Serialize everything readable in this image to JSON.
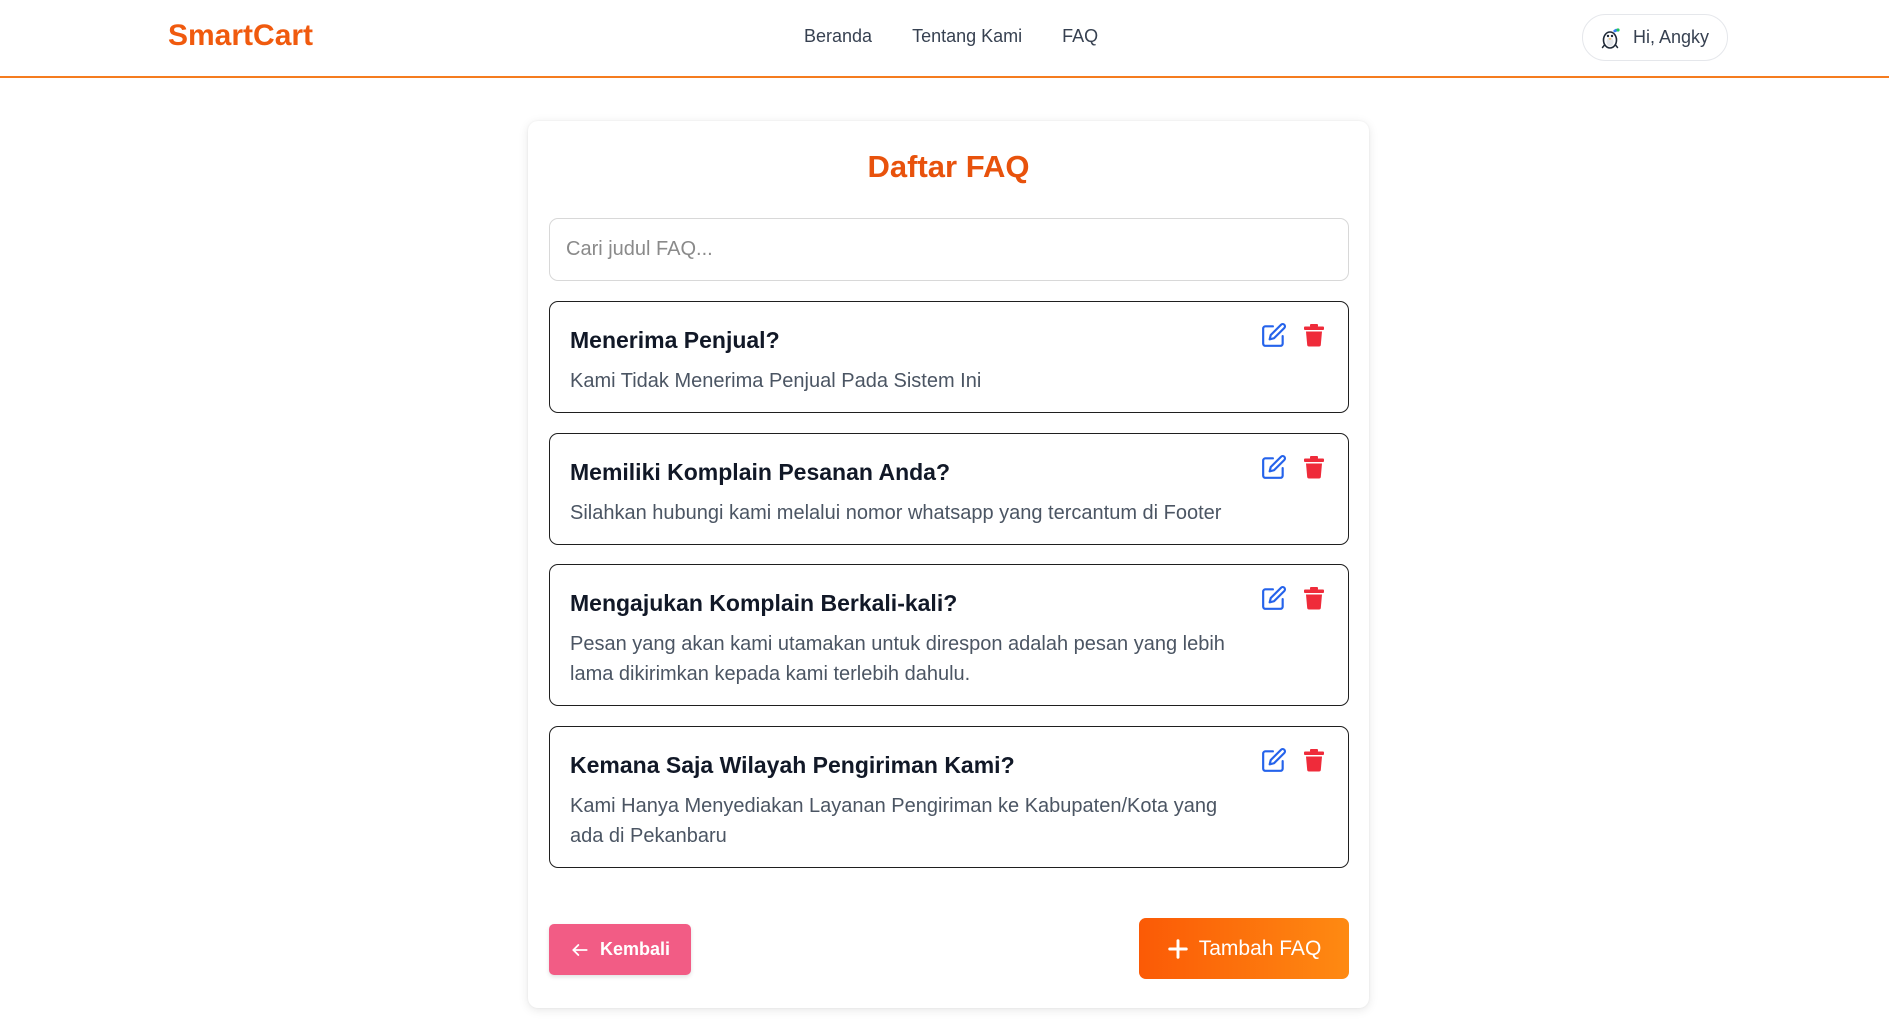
{
  "brand": "SmartCart",
  "nav": {
    "links": [
      "Beranda",
      "Tentang Kami",
      "FAQ"
    ]
  },
  "user": {
    "greeting": "Hi, Angky",
    "avatar_icon": "user-avatar-icon"
  },
  "page": {
    "title": "Daftar FAQ"
  },
  "search": {
    "placeholder": "Cari judul FAQ...",
    "value": ""
  },
  "faqs": [
    {
      "question": "Menerima Penjual?",
      "answer": "Kami Tidak Menerima Penjual Pada Sistem Ini"
    },
    {
      "question": "Memiliki Komplain Pesanan Anda?",
      "answer": "Silahkan hubungi kami melalui nomor whatsapp yang tercantum di Footer"
    },
    {
      "question": "Mengajukan Komplain Berkali-kali?",
      "answer": "Pesan yang akan kami utamakan untuk direspon adalah pesan yang lebih lama dikirimkan kepada kami terlebih dahulu."
    },
    {
      "question": "Kemana Saja Wilayah Pengiriman Kami?",
      "answer": "Kami Hanya Menyediakan Layanan Pengiriman ke Kabupaten/Kota yang ada di Pekanbaru"
    }
  ],
  "actions": {
    "back_label": "Kembali",
    "add_label": "Tambah FAQ"
  },
  "colors": {
    "brand": "#f05a0e",
    "accent_line": "#f57c1f",
    "title": "#e8520c",
    "edit_icon": "#2563eb",
    "delete_icon": "#ef2b3a",
    "back_button": "#f25c85",
    "add_button_start": "#fb5a06",
    "add_button_end": "#fe8a12"
  }
}
